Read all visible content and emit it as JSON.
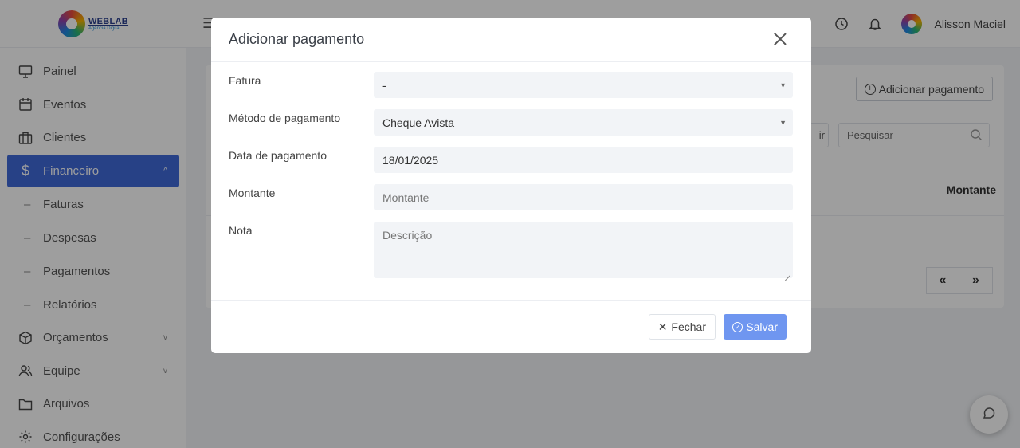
{
  "brand": {
    "logo_line1": "WEBLAB",
    "logo_line2": "Agência Digital"
  },
  "sidebar": {
    "items": [
      {
        "label": "Painel",
        "icon": "monitor-icon"
      },
      {
        "label": "Eventos",
        "icon": "calendar-icon"
      },
      {
        "label": "Clientes",
        "icon": "briefcase-icon"
      },
      {
        "label": "Financeiro",
        "icon": "dollar-icon",
        "active": true
      }
    ],
    "sub_items": [
      {
        "label": "Faturas"
      },
      {
        "label": "Despesas"
      },
      {
        "label": "Pagamentos"
      },
      {
        "label": "Relatórios"
      }
    ],
    "items_after": [
      {
        "label": "Orçamentos",
        "icon": "box-icon"
      },
      {
        "label": "Equipe",
        "icon": "users-icon"
      },
      {
        "label": "Arquivos",
        "icon": "folder-icon"
      },
      {
        "label": "Configurações",
        "icon": "gear-icon"
      }
    ],
    "active_color": "#3f6ad8"
  },
  "topbar": {
    "username": "Alisson Maciel"
  },
  "background": {
    "add_button_label": "Adicionar pagamento",
    "search_placeholder": "Pesquisar",
    "excel_fragment": "ir",
    "column_header": "Montante",
    "pager_prev": "«",
    "pager_next": "»"
  },
  "modal": {
    "title": "Adicionar pagamento",
    "fields": {
      "fatura": {
        "label": "Fatura",
        "value": "-"
      },
      "metodo": {
        "label": "Método de pagamento",
        "value": "Cheque Avista"
      },
      "data": {
        "label": "Data de pagamento",
        "value": "18/01/2025"
      },
      "montante": {
        "label": "Montante",
        "placeholder": "Montante"
      },
      "nota": {
        "label": "Nota",
        "placeholder": "Descrição"
      }
    },
    "close_label": "Fechar",
    "save_label": "Salvar",
    "save_color": "#6f96f0"
  }
}
